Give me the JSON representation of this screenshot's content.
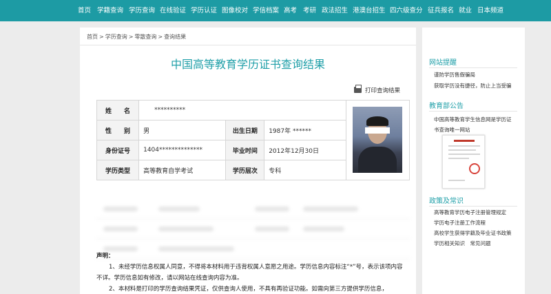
{
  "nav": {
    "items": [
      "首页",
      "学籍查询",
      "学历查询",
      "在线验证",
      "学历认证",
      "图像校对",
      "学信档案",
      "高考",
      "考研",
      "政法招生",
      "港澳台招生",
      "四六级查分",
      "征兵报名",
      "就业",
      "日本频道"
    ]
  },
  "breadcrumb": [
    "首页",
    "学历查询",
    "零散查询",
    "查询结果"
  ],
  "breadcrumb_sep": ">",
  "page_title": "中国高等教育学历证书查询结果",
  "print_label": "打印查询结果",
  "info": {
    "name_label": "姓　　名",
    "name_value": "**********",
    "gender_label": "性　　别",
    "gender_value": "男",
    "birth_label": "出生日期",
    "birth_value": "1987年 ******",
    "id_label": "身份证号",
    "id_value": "1404**************",
    "grad_label": "毕业时间",
    "grad_value": "2012年12月30日",
    "type_label": "学历类型",
    "type_value": "高等教育自学考试",
    "level_label": "学历层次",
    "level_value": "专科"
  },
  "notes": {
    "heading": "声明：",
    "p1": "1、未经学历信息权属人同意，不得将本材料用于违背权属人意愿之用途。学历信息内容标注“*”号，表示该项内容不详。学历信息如有修改，请以网站在线查询内容为准。",
    "p2": "2、本材料是打印的学历查询结果凭证，仅供查询人使用，不具有再验证功能。如需向第三方提供学历信息，"
  },
  "sidebar": {
    "sec1_title": "网站提醒",
    "sec1_links": [
      "谨防学历售假骗局",
      "获取学历没有捷径，防止上当受骗"
    ],
    "sec2_title": "教育部公告",
    "sec2_links": [
      "中国高等教育学生信息网是学历证",
      "书查询唯一网站"
    ],
    "sec3_title": "政策及常识",
    "sec3_links": [
      "高等教育学历电子注册管理规定",
      "学历电子注册工作流程",
      "高校学生获得学籍及毕业证书政策",
      "学历相关知识　常见问题"
    ]
  },
  "colors": {
    "brand": "#1d9ba4",
    "title": "#1f9fa8"
  }
}
